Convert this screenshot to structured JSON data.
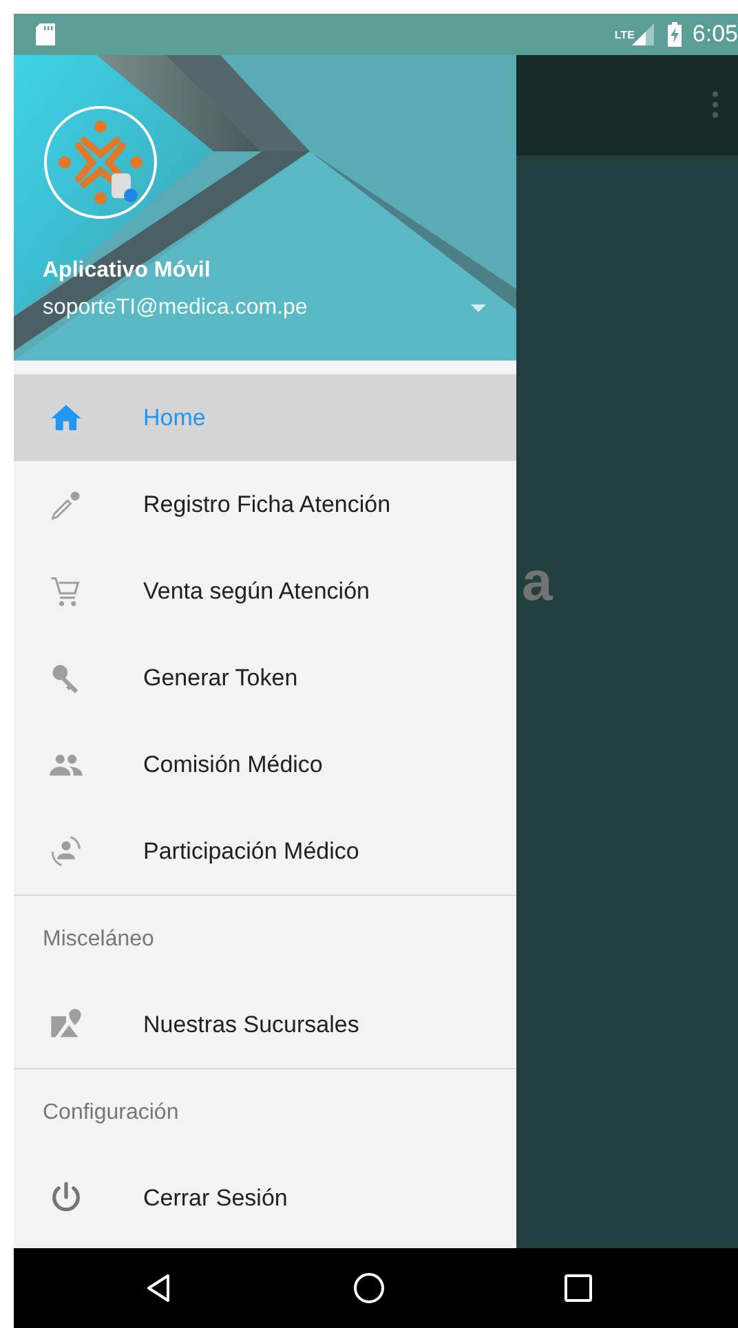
{
  "status_bar": {
    "network": "LTE",
    "time": "6:05"
  },
  "drawer": {
    "header": {
      "name": "Aplicativo Móvil",
      "email": "soporteTI@medica.com.pe"
    },
    "sections": [
      {
        "items": [
          {
            "label": "Home",
            "selected": true
          },
          {
            "label": "Registro Ficha Atención",
            "selected": false
          },
          {
            "label": "Venta según Atención",
            "selected": false
          },
          {
            "label": "Generar Token",
            "selected": false
          },
          {
            "label": "Comisión Médico",
            "selected": false
          },
          {
            "label": "Participación Médico",
            "selected": false
          }
        ]
      },
      {
        "title": "Misceláneo",
        "items": [
          {
            "label": "Nuestras Sucursales",
            "selected": false
          }
        ]
      },
      {
        "title": "Configuración",
        "items": [
          {
            "label": "Cerrar Sesión",
            "selected": false
          }
        ]
      }
    ]
  },
  "background_screen": {
    "title_fragment": "a"
  }
}
